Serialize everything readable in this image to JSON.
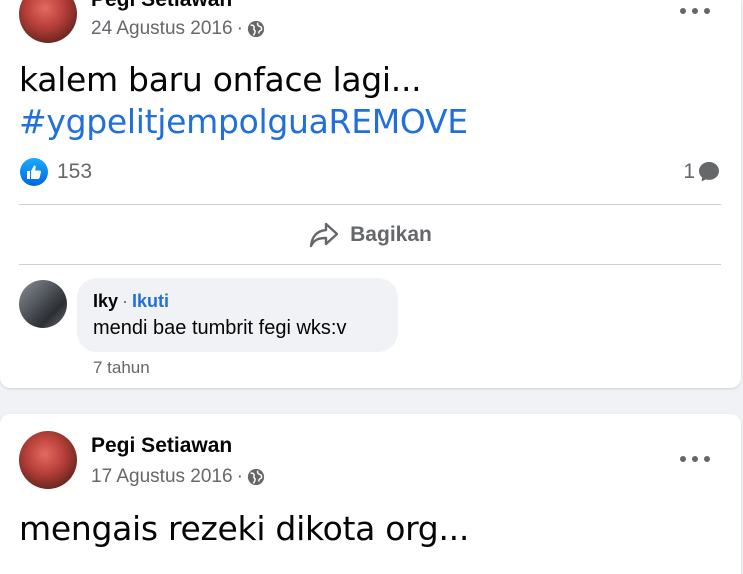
{
  "posts": [
    {
      "author": "Pegi Setiawan",
      "date": "24 Agustus 2016",
      "separator": "·",
      "text": "kalem baru onface lagi...",
      "hashtag": "#ygpelitjempolguaREMOVE",
      "reaction_count": "153",
      "comment_count": "1",
      "share_label": "Bagikan",
      "comment": {
        "author": "Iky",
        "separator": "·",
        "follow_label": "Ikuti",
        "text": "mendi bae tumbrit fegi wks:v",
        "time": "7 tahun"
      }
    },
    {
      "author": "Pegi Setiawan",
      "date": "17 Agustus 2016",
      "separator": "·",
      "text": "mengais rezeki dikota org..."
    }
  ],
  "colors": {
    "accent": "#216fdb",
    "like_badge": "#0866ff",
    "secondary_text": "#65676b",
    "background": "#f0f2f5"
  },
  "icons": {
    "privacy": "globe-icon",
    "menu": "more-horizontal-icon",
    "like": "thumbs-up-icon",
    "comment": "comment-bubble-icon",
    "share": "share-arrow-icon"
  }
}
